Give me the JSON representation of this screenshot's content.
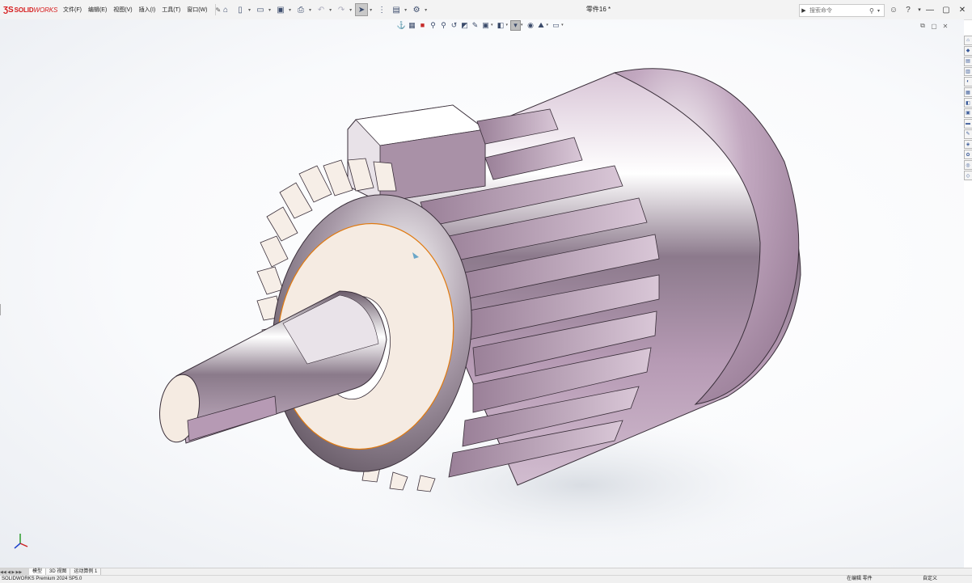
{
  "app": {
    "brand_solid": "SOLID",
    "brand_works": "WORKS"
  },
  "menu": {
    "file": "文件(F)",
    "edit": "编辑(E)",
    "view": "视图(V)",
    "insert": "插入(I)",
    "tools": "工具(T)",
    "window": "窗口(W)"
  },
  "document_title": "零件16 *",
  "search": {
    "placeholder": "搜索命令"
  },
  "tabs": [
    {
      "label": "模型",
      "active": true
    },
    {
      "label": "3D 视图",
      "active": false
    },
    {
      "label": "运动算例 1",
      "active": false
    }
  ],
  "status": {
    "product": "SOLIDWORKS Premium 2024 SP5.0",
    "editing": "在编辑 零件",
    "units": "自定义"
  },
  "colors": {
    "brand": "#d61b1b",
    "viewport_bg": "#f4f6f9",
    "body_metal": "#b79bb6",
    "face_cream": "#f5ebe2",
    "selection_edge": "#e07a10"
  },
  "icons": {
    "quick_access": [
      "home-icon",
      "new-icon",
      "open-icon",
      "save-icon",
      "print-icon",
      "undo-icon",
      "redo-icon",
      "select-icon",
      "traffic-light-icon",
      "file-properties-icon",
      "options-icon"
    ],
    "heads_up": [
      "view-orientation-icon",
      "section-icon",
      "appearance-red-icon",
      "zoom-to-fit-icon",
      "zoom-area-icon",
      "previous-view-icon",
      "section-view-icon",
      "dynamic-annotation-icon",
      "view-orientation-cube-icon",
      "display-style-icon",
      "hide-show-icon",
      "edit-appearance-icon",
      "apply-scene-icon",
      "view-settings-icon"
    ]
  }
}
